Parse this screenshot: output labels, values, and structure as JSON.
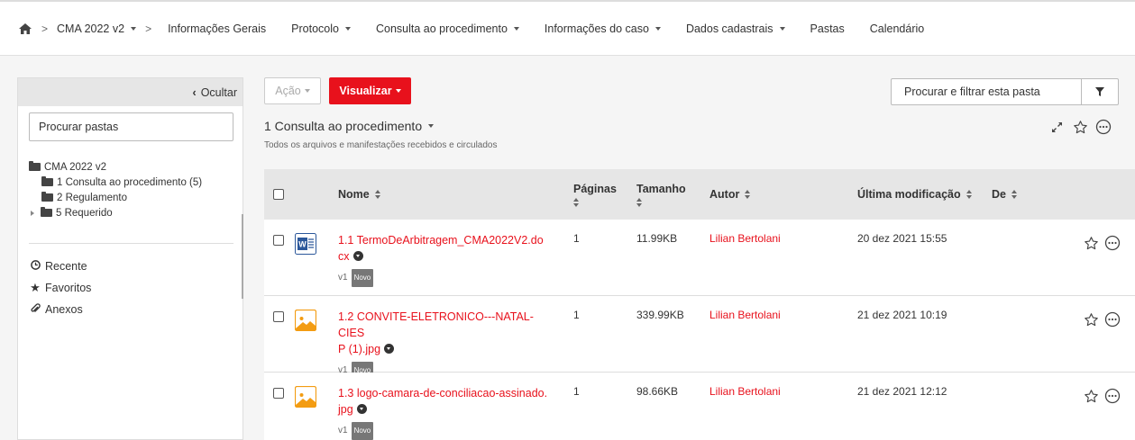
{
  "nav": {
    "crumb": "CMA 2022 v2",
    "items": [
      {
        "label": "Informações Gerais",
        "dropdown": false
      },
      {
        "label": "Protocolo",
        "dropdown": true
      },
      {
        "label": "Consulta ao procedimento",
        "dropdown": true
      },
      {
        "label": "Informações do caso",
        "dropdown": true
      },
      {
        "label": "Dados cadastrais",
        "dropdown": true
      },
      {
        "label": "Pastas",
        "dropdown": false
      },
      {
        "label": "Calendário",
        "dropdown": false
      }
    ]
  },
  "sidebar": {
    "hide_label": "Ocultar",
    "search_placeholder": "Procurar pastas",
    "tree": {
      "root": "CMA 2022 v2",
      "children": [
        {
          "label": "1 Consulta ao procedimento",
          "count": "(5)"
        },
        {
          "label": "2 Regulamento",
          "count": ""
        },
        {
          "label": "5 Requerido",
          "count": ""
        }
      ]
    },
    "links": [
      {
        "label": "Recente",
        "icon": "clock-icon"
      },
      {
        "label": "Favoritos",
        "icon": "star-icon"
      },
      {
        "label": "Anexos",
        "icon": "paperclip-icon"
      }
    ]
  },
  "toolbar": {
    "action_label": "Ação",
    "view_label": "Visualizar",
    "search_placeholder": "Procurar e filtrar esta pasta"
  },
  "folder": {
    "title": "1 Consulta ao procedimento",
    "subtitle": "Todos os arquivos e manifestações recebidos e circulados"
  },
  "table": {
    "headers": {
      "name": "Nome",
      "pages": "Páginas",
      "size": "Tamanho",
      "author": "Autor",
      "modified": "Última modificação",
      "from": "De"
    },
    "rows": [
      {
        "index": "1.1",
        "name": "TermoDeArbitragem_CMA2022V2.docx",
        "name_lines": [
          "1.1 TermoDeArbitragem_CMA2022V2.do",
          "cx"
        ],
        "type": "word",
        "version": "v1",
        "badge": "Novo",
        "pages": "1",
        "size": "11.99KB",
        "author": "Lilian Bertolani",
        "modified": "20 dez 2021 15:55"
      },
      {
        "index": "1.2",
        "name": "CONVITE-ELETRONICO---NATAL-CIESP (1).jpg",
        "name_lines": [
          "1.2 CONVITE-ELETRONICO---NATAL-CIES",
          "P (1).jpg"
        ],
        "type": "image",
        "version": "v1",
        "badge": "Novo",
        "pages": "1",
        "size": "339.99KB",
        "author": "Lilian Bertolani",
        "modified": "21 dez 2021 10:19"
      },
      {
        "index": "1.3",
        "name": "logo-camara-de-conciliacao-assinado.jpg",
        "name_lines": [
          "1.3 logo-camara-de-conciliacao-assinado.",
          "jpg"
        ],
        "type": "image",
        "version": "v1",
        "badge": "Novo",
        "pages": "1",
        "size": "98.66KB",
        "author": "Lilian Bertolani",
        "modified": "21 dez 2021 12:12"
      }
    ]
  },
  "colors": {
    "accent": "#e8111c",
    "word": "#2b579a",
    "image": "#f39c12"
  }
}
